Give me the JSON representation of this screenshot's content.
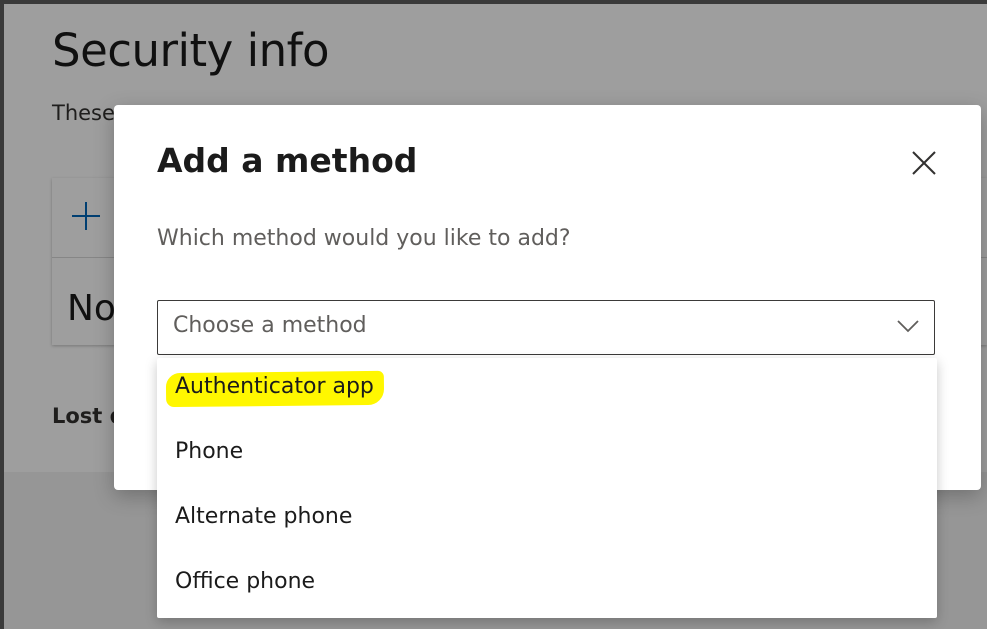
{
  "page": {
    "title": "Security info",
    "description_partial": "These",
    "no_items_partial": "No",
    "lost_device_partial": "Lost d"
  },
  "dialog": {
    "title": "Add a method",
    "prompt": "Which method would you like to add?",
    "select": {
      "placeholder": "Choose a method",
      "options": [
        {
          "label": "Authenticator app",
          "highlighted": true
        },
        {
          "label": "Phone"
        },
        {
          "label": "Alternate phone"
        },
        {
          "label": "Office phone"
        }
      ]
    }
  },
  "icons": {
    "add": "plus-icon",
    "close": "close-icon",
    "dropdown": "chevron-down-icon"
  },
  "colors": {
    "accent": "#0067b8",
    "highlight": "#fff700",
    "overlay": "rgba(0,0,0,0.38)"
  }
}
